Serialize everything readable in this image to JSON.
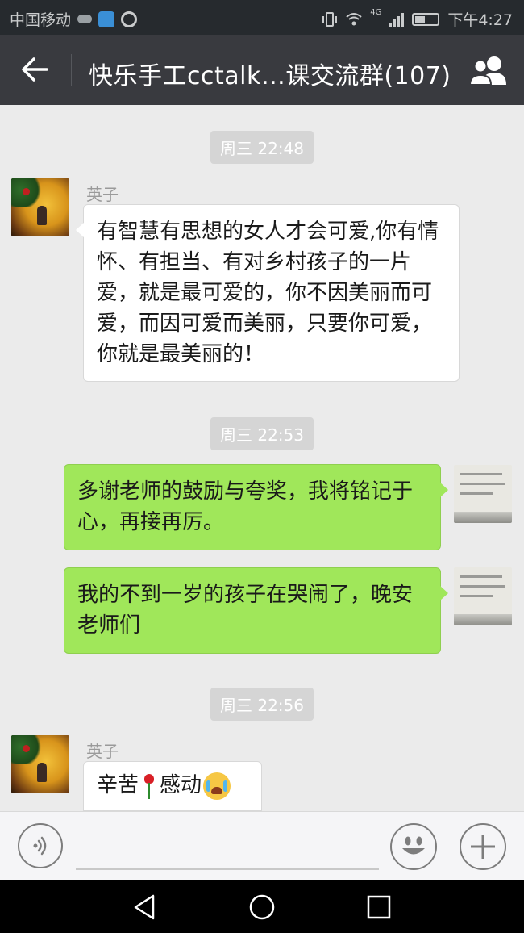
{
  "status_bar": {
    "carrier": "中国移动",
    "network": "4G",
    "time": "下午4:27"
  },
  "header": {
    "title": "快乐手工cctalk…课交流群(107)"
  },
  "messages": [
    {
      "type": "time",
      "text": "周三 22:48"
    },
    {
      "type": "incoming",
      "sender": "英子",
      "text": "有智慧有思想的女人才会可爱,你有情怀、有担当、有对乡村孩子的一片爱，就是最可爱的，你不因美丽而可爱，而因可爱而美丽，只要你可爱，你就是最美丽的！"
    },
    {
      "type": "time",
      "text": "周三 22:53"
    },
    {
      "type": "outgoing",
      "text": "多谢老师的鼓励与夸奖，我将铭记于心，再接再厉。"
    },
    {
      "type": "outgoing",
      "text": "我的不到一岁的孩子在哭闹了，晚安老师们"
    },
    {
      "type": "time",
      "text": "周三 22:56"
    },
    {
      "type": "incoming",
      "sender": "英子",
      "text_before": "辛苦",
      "emoji_1": "rose-emoji",
      "text_after": "感动",
      "emoji_2": "crying-emoji"
    }
  ],
  "icons": {
    "back": "back-arrow-icon",
    "group": "group-members-icon",
    "voice": "voice-input-icon",
    "emoji": "emoji-icon",
    "more": "plus-icon"
  },
  "colors": {
    "titlebar": "#393a3f",
    "outgoing_bubble": "#a0e75a",
    "incoming_bubble": "#ffffff",
    "chat_background": "#ebebeb"
  }
}
